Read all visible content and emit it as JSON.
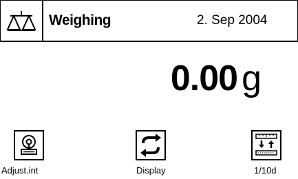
{
  "header": {
    "title": "Weighing",
    "date": "2. Sep 2004",
    "icon": "balance-scale-icon"
  },
  "readout": {
    "value": "0.00",
    "unit": "g"
  },
  "function_keys": [
    {
      "label": "Adjust.int",
      "icon": "internal-adjustment-icon"
    },
    {
      "label": "Display",
      "icon": "refresh-display-icon"
    },
    {
      "label": "1/10d",
      "icon": "tenth-digit-icon"
    }
  ]
}
